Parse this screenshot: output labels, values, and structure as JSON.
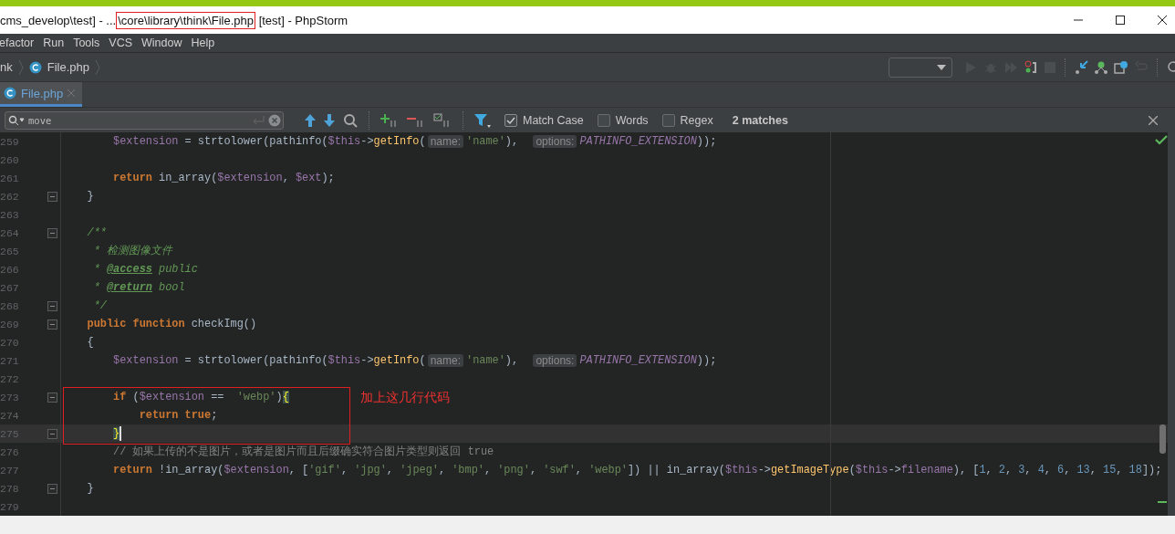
{
  "window": {
    "title_before": "cms_develop\\test] - ...",
    "title_highlight": "\\core\\library\\think\\File.php",
    "title_after": " [test] - PhpStorm"
  },
  "menu": [
    "efactor",
    "Run",
    "Tools",
    "VCS",
    "Window",
    "Help"
  ],
  "breadcrumbs": [
    {
      "label": "nk",
      "kind": "folder"
    },
    {
      "label": "File.php",
      "kind": "class"
    }
  ],
  "tabs": [
    {
      "label": "File.php",
      "selected": true
    }
  ],
  "search": {
    "value": "move",
    "options": [
      {
        "label": "Match Case",
        "checked": true
      },
      {
        "label": "Words",
        "checked": false
      },
      {
        "label": "Regex",
        "checked": false
      }
    ],
    "matches": "2 matches"
  },
  "lines": [
    {
      "number": "259",
      "fold": false,
      "current": false,
      "tokens": [
        {
          "kind": "var",
          "text": "        $extension"
        },
        {
          "kind": "plain",
          "text": " = strtolower(pathinfo("
        },
        {
          "kind": "var",
          "text": "$this"
        },
        {
          "kind": "plain",
          "text": "->"
        },
        {
          "kind": "func",
          "text": "getInfo"
        },
        {
          "kind": "plain",
          "text": "("
        },
        {
          "kind": "hint",
          "text": "name:"
        },
        {
          "kind": "string",
          "text": "'name'"
        },
        {
          "kind": "plain",
          "text": "),  "
        },
        {
          "kind": "hint",
          "text": "options:"
        },
        {
          "kind": "const",
          "text": "PATHINFO_EXTENSION"
        },
        {
          "kind": "plain",
          "text": "));"
        }
      ]
    },
    {
      "number": "260",
      "fold": false,
      "current": false
    },
    {
      "number": "261",
      "fold": false,
      "current": false,
      "tokens": [
        {
          "kind": "keyword",
          "text": "        return"
        },
        {
          "kind": "plain",
          "text": " in_array("
        },
        {
          "kind": "var",
          "text": "$extension"
        },
        {
          "kind": "plain",
          "text": ", "
        },
        {
          "kind": "var",
          "text": "$ext"
        },
        {
          "kind": "plain",
          "text": ");"
        }
      ]
    },
    {
      "number": "262",
      "fold": true,
      "current": false,
      "tokens": [
        {
          "kind": "plain",
          "text": "    }"
        }
      ]
    },
    {
      "number": "263",
      "fold": false,
      "current": false
    },
    {
      "number": "264",
      "fold": true,
      "current": false,
      "tokens": [
        {
          "kind": "doc",
          "text": "    /**"
        }
      ]
    },
    {
      "number": "265",
      "fold": false,
      "current": false,
      "tokens": [
        {
          "kind": "doc",
          "text": "     * 检测图像文件"
        }
      ]
    },
    {
      "number": "266",
      "fold": false,
      "current": false,
      "tokens": [
        {
          "kind": "doc",
          "text": "     * "
        },
        {
          "kind": "doctag",
          "text": "@access"
        },
        {
          "kind": "doc",
          "text": " public"
        }
      ]
    },
    {
      "number": "267",
      "fold": false,
      "current": false,
      "tokens": [
        {
          "kind": "doc",
          "text": "     * "
        },
        {
          "kind": "doctag",
          "text": "@return"
        },
        {
          "kind": "doc",
          "text": " bool"
        }
      ]
    },
    {
      "number": "268",
      "fold": true,
      "current": false,
      "tokens": [
        {
          "kind": "doc",
          "text": "     */"
        }
      ]
    },
    {
      "number": "269",
      "fold": true,
      "current": false,
      "tokens": [
        {
          "kind": "keyword",
          "text": "    public function "
        },
        {
          "kind": "plain",
          "text": "checkImg()"
        }
      ]
    },
    {
      "number": "270",
      "fold": false,
      "current": false,
      "tokens": [
        {
          "kind": "plain",
          "text": "    {"
        }
      ]
    },
    {
      "number": "271",
      "fold": false,
      "current": false,
      "tokens": [
        {
          "kind": "var",
          "text": "        $extension"
        },
        {
          "kind": "plain",
          "text": " = strtolower(pathinfo("
        },
        {
          "kind": "var",
          "text": "$this"
        },
        {
          "kind": "plain",
          "text": "->"
        },
        {
          "kind": "func",
          "text": "getInfo"
        },
        {
          "kind": "plain",
          "text": "("
        },
        {
          "kind": "hint",
          "text": "name:"
        },
        {
          "kind": "string",
          "text": "'name'"
        },
        {
          "kind": "plain",
          "text": "),  "
        },
        {
          "kind": "hint",
          "text": "options:"
        },
        {
          "kind": "const",
          "text": "PATHINFO_EXTENSION"
        },
        {
          "kind": "plain",
          "text": "));"
        }
      ]
    },
    {
      "number": "272",
      "fold": false,
      "current": false
    },
    {
      "number": "273",
      "fold": true,
      "current": false,
      "tokens": [
        {
          "kind": "keyword",
          "text": "        if"
        },
        {
          "kind": "plain",
          "text": " ("
        },
        {
          "kind": "var",
          "text": "$extension"
        },
        {
          "kind": "plain",
          "text": " ==  "
        },
        {
          "kind": "string",
          "text": "'webp'"
        },
        {
          "kind": "plain",
          "text": ")"
        },
        {
          "kind": "brace",
          "text": "{"
        }
      ]
    },
    {
      "number": "274",
      "fold": false,
      "current": false,
      "tokens": [
        {
          "kind": "keyword",
          "text": "            return true"
        },
        {
          "kind": "plain",
          "text": ";"
        }
      ]
    },
    {
      "number": "275",
      "fold": true,
      "current": true,
      "tokens": [
        {
          "kind": "brace",
          "text": "}"
        }
      ]
    },
    {
      "number": "276",
      "fold": false,
      "current": false,
      "tokens": [
        {
          "kind": "comment",
          "text": "        // 如果上传的不是图片，或者是图片而且后缀确实符合图片类型则返回 true"
        }
      ]
    },
    {
      "number": "277",
      "fold": false,
      "current": false,
      "tokens": [
        {
          "kind": "keyword",
          "text": "        return"
        },
        {
          "kind": "plain",
          "text": " !in_array("
        },
        {
          "kind": "var",
          "text": "$extension"
        },
        {
          "kind": "plain",
          "text": ", ["
        },
        {
          "kind": "string",
          "text": "'gif'"
        },
        {
          "kind": "plain",
          "text": ", "
        },
        {
          "kind": "string",
          "text": "'jpg'"
        },
        {
          "kind": "plain",
          "text": ", "
        },
        {
          "kind": "string",
          "text": "'jpeg'"
        },
        {
          "kind": "plain",
          "text": ", "
        },
        {
          "kind": "string",
          "text": "'bmp'"
        },
        {
          "kind": "plain",
          "text": ", "
        },
        {
          "kind": "string",
          "text": "'png'"
        },
        {
          "kind": "plain",
          "text": ", "
        },
        {
          "kind": "string",
          "text": "'swf'"
        },
        {
          "kind": "plain",
          "text": ", "
        },
        {
          "kind": "string",
          "text": "'webp'"
        },
        {
          "kind": "plain",
          "text": "]) || in_array("
        },
        {
          "kind": "var",
          "text": "$this"
        },
        {
          "kind": "plain",
          "text": "->"
        },
        {
          "kind": "func",
          "text": "getImageType"
        },
        {
          "kind": "plain",
          "text": "("
        },
        {
          "kind": "var",
          "text": "$this"
        },
        {
          "kind": "plain",
          "text": "->"
        },
        {
          "kind": "var",
          "text": "filename"
        },
        {
          "kind": "plain",
          "text": "), ["
        },
        {
          "kind": "number",
          "text": "1"
        },
        {
          "kind": "plain",
          "text": ", "
        },
        {
          "kind": "number",
          "text": "2"
        },
        {
          "kind": "plain",
          "text": ", "
        },
        {
          "kind": "number",
          "text": "3"
        },
        {
          "kind": "plain",
          "text": ", "
        },
        {
          "kind": "number",
          "text": "4"
        },
        {
          "kind": "plain",
          "text": ", "
        },
        {
          "kind": "number",
          "text": "6"
        },
        {
          "kind": "plain",
          "text": ", "
        },
        {
          "kind": "number",
          "text": "13"
        },
        {
          "kind": "plain",
          "text": ", "
        },
        {
          "kind": "number",
          "text": "15"
        },
        {
          "kind": "plain",
          "text": ", "
        },
        {
          "kind": "number",
          "text": "18"
        },
        {
          "kind": "plain",
          "text": "]);"
        }
      ]
    },
    {
      "number": "278",
      "fold": true,
      "current": false,
      "tokens": [
        {
          "kind": "plain",
          "text": "    }"
        }
      ]
    },
    {
      "number": "279",
      "fold": false,
      "current": false
    }
  ],
  "annotation": {
    "text": "加上这几行代码"
  }
}
